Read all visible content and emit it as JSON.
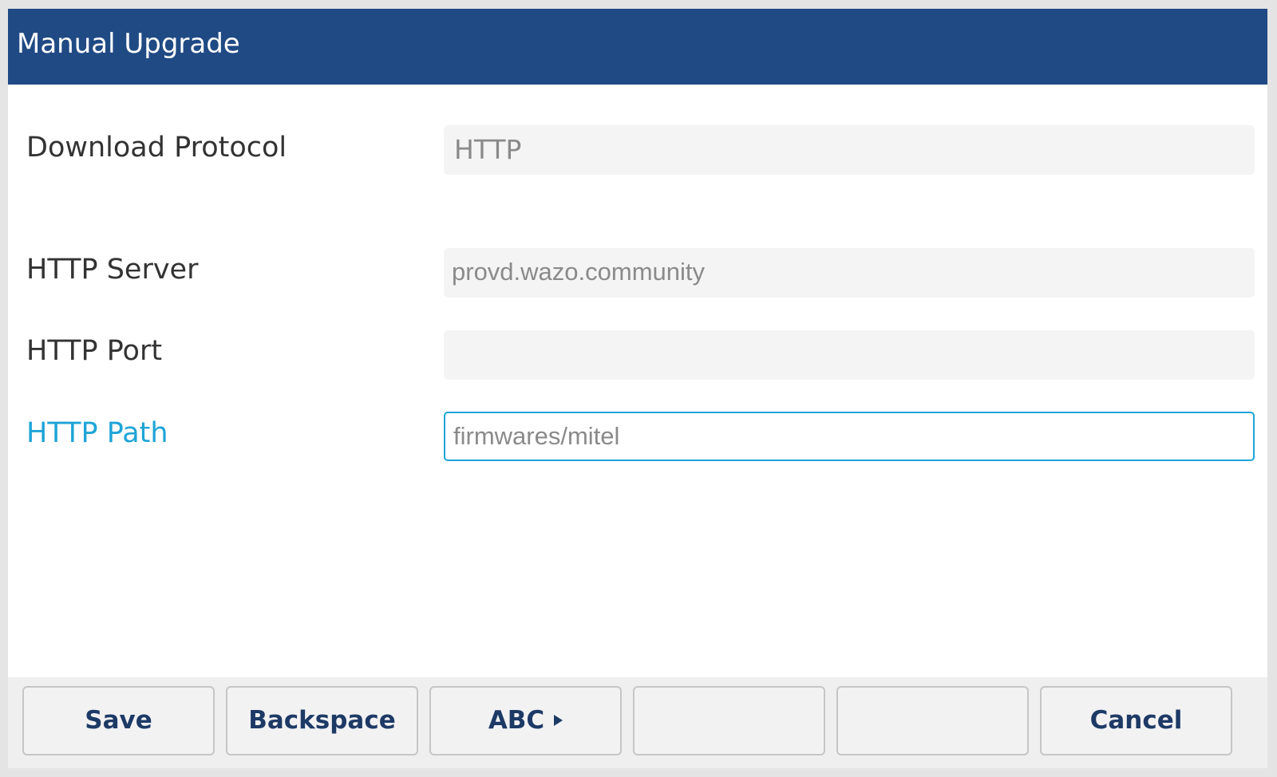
{
  "window": {
    "title": "Manual Upgrade"
  },
  "form": {
    "download_protocol": {
      "label": "Download Protocol",
      "value": "HTTP"
    },
    "http_server": {
      "label": "HTTP Server",
      "value": "provd.wazo.community"
    },
    "http_port": {
      "label": "HTTP Port",
      "value": ""
    },
    "http_path": {
      "label": "HTTP Path",
      "value": "firmwares/mitel",
      "focused": true
    }
  },
  "softkeys": [
    {
      "label": "Save"
    },
    {
      "label": "Backspace"
    },
    {
      "label": "ABC",
      "icon": "triangle-right-icon"
    },
    {
      "label": ""
    },
    {
      "label": ""
    },
    {
      "label": "Cancel"
    }
  ],
  "colors": {
    "title_bar": "#204a84",
    "focus_accent": "#1ea4d7",
    "softkey_text": "#1d3a66"
  }
}
